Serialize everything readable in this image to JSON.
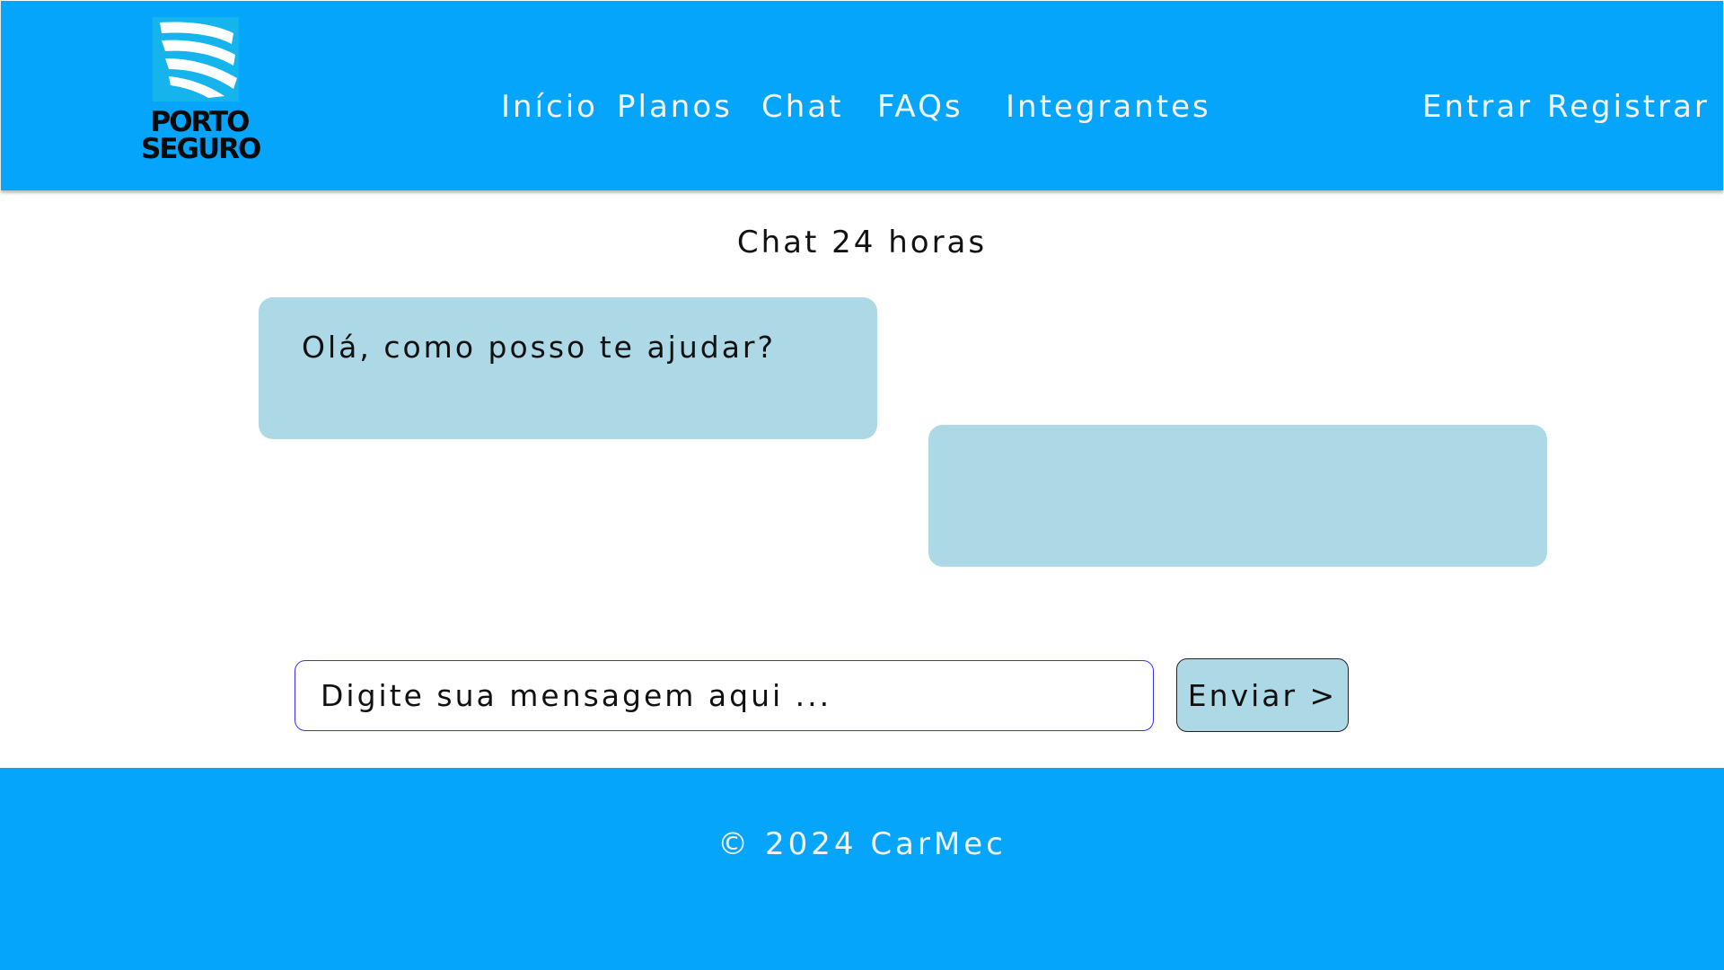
{
  "header": {
    "logo": {
      "line1": "PORTO",
      "line2": "SEGURO"
    },
    "nav": {
      "inicio": "Início",
      "planos": "Planos",
      "chat": "Chat",
      "faqs": "FAQs",
      "integrantes": "Integrantes"
    },
    "auth": {
      "entrar": "Entrar",
      "registrar": "Registrar"
    }
  },
  "main": {
    "title": "Chat 24 horas",
    "messages": {
      "bot_greeting": "Olá, como posso te ajudar?",
      "user_reply": ""
    },
    "composer": {
      "placeholder": "Digite sua mensagem aqui ...",
      "value": "",
      "send_label": "Enviar >"
    }
  },
  "footer": {
    "copyright": "© 2024 CarMec"
  },
  "colors": {
    "brand_blue": "#05a5fc",
    "bubble": "#add8e6",
    "input_border": "#3a2ff0",
    "nav_text": "#f4f4f4"
  },
  "icons": {
    "logo": "porto-seguro-sail-logo"
  }
}
